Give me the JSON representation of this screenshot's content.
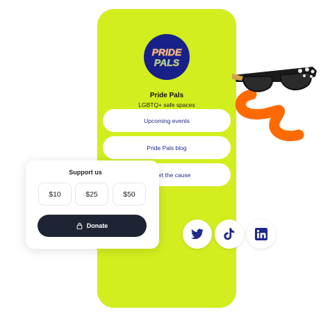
{
  "profile": {
    "logo_text_line1": "PRIDE",
    "logo_text_line2": "PALS",
    "name": "Pride Pals",
    "bio": "LGBTQ+ safe spaces"
  },
  "links": [
    {
      "label": "Upcoming events"
    },
    {
      "label": "Pride Pals blog"
    },
    {
      "label": "Support the cause"
    }
  ],
  "support": {
    "title": "Support us",
    "amounts": [
      "$10",
      "$25",
      "$50"
    ],
    "donate_label": "Donate"
  },
  "social": [
    "twitter-icon",
    "tiktok-icon",
    "linkedin-icon"
  ],
  "colors": {
    "accent": "#d3ee1f",
    "brand_navy": "#18208a",
    "link_text": "#1e2a8a",
    "donate_bg": "#1e2433"
  }
}
